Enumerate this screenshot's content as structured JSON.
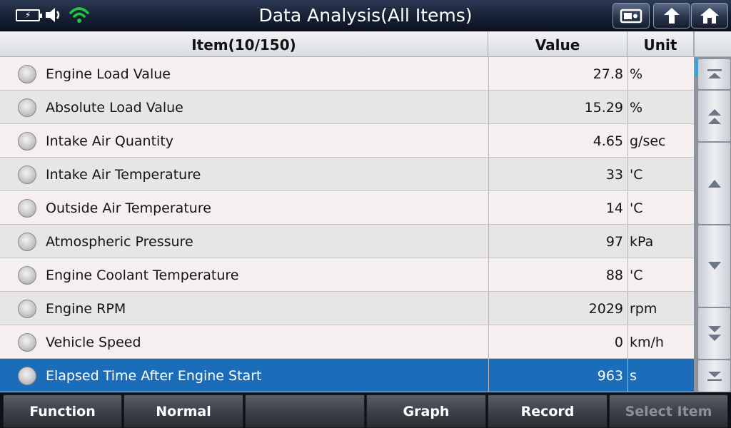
{
  "header": {
    "title": "Data Analysis(All Items)",
    "battery_icon": "battery-charging-icon",
    "sound_icon": "speaker-icon",
    "wifi_icon": "wifi-icon",
    "wifi_color": "#22c740",
    "buttons": [
      {
        "name": "screenshot-button",
        "icon": "camera-icon"
      },
      {
        "name": "back-button",
        "icon": "return-arrow-icon"
      },
      {
        "name": "home-button",
        "icon": "home-icon"
      }
    ]
  },
  "table": {
    "columns": {
      "item": "Item(10/150)",
      "value": "Value",
      "unit": "Unit"
    },
    "rows": [
      {
        "name": "Engine Load Value",
        "value": "27.8",
        "unit": "%"
      },
      {
        "name": "Absolute Load Value",
        "value": "15.29",
        "unit": "%"
      },
      {
        "name": "Intake Air Quantity",
        "value": "4.65",
        "unit": "g/sec"
      },
      {
        "name": "Intake Air Temperature",
        "value": "33",
        "unit": "'C"
      },
      {
        "name": "Outside Air Temperature",
        "value": "14",
        "unit": "'C"
      },
      {
        "name": "Atmospheric Pressure",
        "value": "97",
        "unit": "kPa"
      },
      {
        "name": "Engine Coolant Temperature",
        "value": "88",
        "unit": "'C"
      },
      {
        "name": "Engine RPM",
        "value": "2029",
        "unit": "rpm"
      },
      {
        "name": "Vehicle Speed",
        "value": "0",
        "unit": "km/h"
      },
      {
        "name": "Elapsed Time After Engine Start",
        "value": "963",
        "unit": "s",
        "selected": true
      }
    ],
    "selected_color": "#1b6db9"
  },
  "scroll": {
    "buttons": [
      "scroll-top-icon",
      "page-up-icon",
      "scroll-up-icon",
      "scroll-down-icon",
      "page-down-icon",
      "scroll-bottom-icon"
    ]
  },
  "footer": {
    "buttons": [
      "Function",
      "Normal",
      "",
      "Graph",
      "Record",
      "Select Item"
    ]
  }
}
